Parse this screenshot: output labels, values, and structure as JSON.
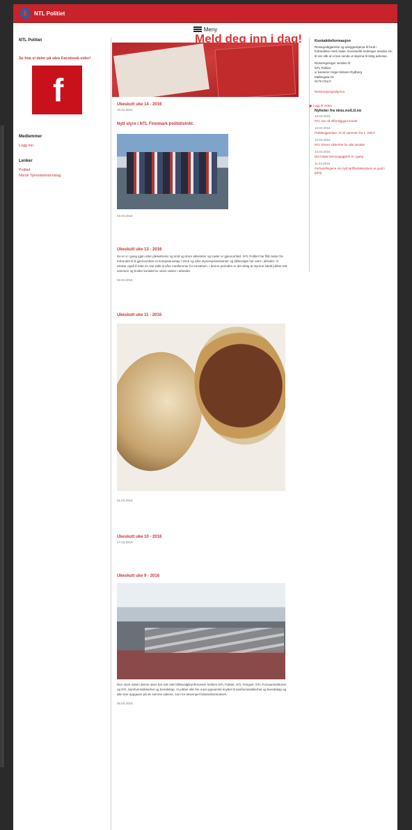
{
  "header": {
    "site_title": "NTL Politiet",
    "menu_label": "Meny"
  },
  "left": {
    "title": "NTL Politiet",
    "facebook_text": "Se hva vi deler på våre Facebook-sider!",
    "members_heading": "Medlemmer",
    "login_link": "Logg inn",
    "links_heading": "Lenker",
    "links": [
      "Politiet",
      "Norsk Tjenestemannslag"
    ]
  },
  "promo": {
    "headline": "Meld deg inn i dag!"
  },
  "posts": [
    {
      "title": "Ukeskutt uke 14 - 2016",
      "date": "10.04.2016",
      "subtitle": "Nytt styre i NTL Finnmark politidistrikt.",
      "img_date": "10.04.2016"
    },
    {
      "title": "Ukeskutt uke 13 - 2016",
      "body": "De er vi i gang igjen etter påskeferien og små og store aktiviteter og møter er gjennomført. NTL Politiet har fått møter fra forbundet til å gjennomføre et kompetanseløp i 2016 og våre styrerepresentanter og tillitsvalgte har vært i aktivitet. Vi ønsker også å rette en stor takk til våre medlemmer for innsatsen. I denne perioden er det viktig at styrene lokalt jobber tett sammen og holder kontakt for veien videre i arbeidet.",
      "date": "03.04.2016"
    },
    {
      "title": "Ukeskutt uke 11 - 2016",
      "date": "21.03.2016"
    },
    {
      "title": "Ukeskutt uke 10 - 2016",
      "date": "17.03.2016"
    },
    {
      "title": "Ukeskutt uke 9 - 2016",
      "body": "Den store saken denne uken har nok vært tillitsvalgtkonferansen mellom NTL Politiet, NTL Fengsel, NTL Forsvarssektoren og NTL Samfunnssikkerhet og beredskap. Vi jobber alle fire med oppsamlet knyttet til samfunnssikkerhet og beredskap og alle sine oppgaver på de samme sakene, som for eksempel bistandsinstruksen.",
      "date": "06.03.2016"
    }
  ],
  "right": {
    "contact_heading": "Kontaktinformasjon",
    "contact_text": "Reisegodtgjørelse og utleggsskjema til bruk i forbindelse med møter. Eventuelle endringer sendes inn til oss slik at vi kan sende ut skjema til riktig adresse.",
    "address_label": "Reiseregninger sendes til:",
    "address_lines": [
      "NTL Politiet",
      "v/ kasserer Hege Nilssen Rydberg",
      "Møllergata 19",
      "0179 OSLO"
    ],
    "form_link": "Reiseregningsskjema",
    "video_link": "Logg til Video",
    "news_heading": "Nyheter fra ntnu.no/Ltl.no",
    "news": [
      {
        "date": "13.04.2016",
        "title": "NTL har nå offentliggjort kravet"
      },
      {
        "date": "13.04.2016",
        "title": "Politiavgjørelser: Fri til sammen fra 1. Oslo?"
      },
      {
        "date": "13.04.2016",
        "title": "NTL krever sikkerhet for alle ansatte"
      },
      {
        "date": "13.04.2016",
        "title": "Det lokale lønnsoppgjøret er i gang"
      },
      {
        "date": "11.04.2016",
        "title": "Forhandlingene om nytt tariffavtalesystem er godt i gang"
      }
    ]
  }
}
